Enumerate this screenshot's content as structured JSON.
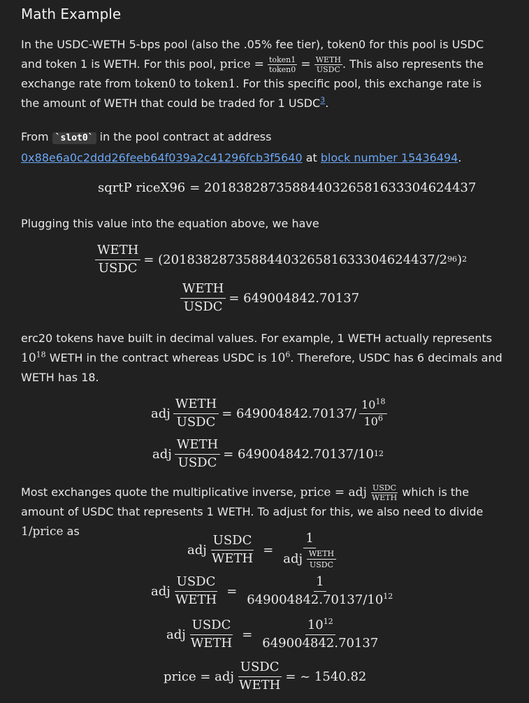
{
  "title": "Math Example",
  "p1": {
    "a": "In the USDC-WETH 5-bps pool (also the .05% fee tier), token0 for this pool is USDC and token 1 is WETH. For this pool, ",
    "price": "price",
    "eq": "=",
    "token1": "token1",
    "token0": "token0",
    "weth": "WETH",
    "usdc": "USDC",
    "b": ". This also represents the exchange rate from ",
    "t0": "token0",
    "to": " to ",
    "t1": "token1",
    "c": ". For this specific pool, this exchange rate is the amount of WETH that could be traded for 1 USDC",
    "footnote": "3",
    "d": "."
  },
  "p2": {
    "from": "From ",
    "code": "`slot0`",
    "mid": " in the pool contract at address",
    "address": "0x88e6a0c2ddd26feeb64f039a2c41296fcb3f5640",
    "at": " at ",
    "block": "block number 15436494",
    "end": "."
  },
  "eq1": {
    "lhs": "sqrtP riceX96",
    "rhs": "= 2018382873588440326581633304624437"
  },
  "p3": "Plugging this value into the equation above, we have",
  "eq2": {
    "num": "WETH",
    "den": "USDC",
    "rhs": "= (2018382873588440326581633304624437/2",
    "exp": "96",
    "close": ")",
    "exp2": "2"
  },
  "eq3": {
    "num": "WETH",
    "den": "USDC",
    "rhs": "= 649004842.70137"
  },
  "p4": {
    "a": "erc20 tokens have built in decimal values. For example, 1 WETH actually represents ",
    "ten": "10",
    "e18": "18",
    "b": " WETH in the contract whereas USDC is ",
    "e6": "6",
    "c": ". Therefore, USDC has 6 decimals and WETH has 18."
  },
  "eq4": {
    "adj": "adj",
    "num": "WETH",
    "den": "USDC",
    "rhs": "= 649004842.70137/",
    "fn": "10",
    "fne": "18",
    "fd": "10",
    "fde": "6"
  },
  "eq5": {
    "adj": "adj",
    "num": "WETH",
    "den": "USDC",
    "rhs": "= 649004842.70137/10",
    "exp": "12"
  },
  "p5": {
    "a": "Most exchanges quote the multiplicative inverse, ",
    "price": "price = adj",
    "usdc": "USDC",
    "weth": "WETH",
    "b": " which is the amount of USDC that represents 1 WETH. To adjust for this, we also need to divide ",
    "inv": "1/price",
    "c": " as"
  },
  "eq6": {
    "adj": "adj",
    "num": "USDC",
    "den": "WETH",
    "eq": "=",
    "one": "1",
    "adj2": "adj",
    "sn": "WETH",
    "sd": "USDC"
  },
  "eq7": {
    "adj": "adj",
    "num": "USDC",
    "den": "WETH",
    "eq": "=",
    "one": "1",
    "den2": "649004842.70137/10",
    "exp": "12"
  },
  "eq8": {
    "adj": "adj",
    "num": "USDC",
    "den": "WETH",
    "eq": "=",
    "ten": "10",
    "exp": "12",
    "den2": "649004842.70137"
  },
  "eq9": {
    "lhs": "price = adj",
    "num": "USDC",
    "den": "WETH",
    "rhs": "= ~ 1540.82"
  }
}
